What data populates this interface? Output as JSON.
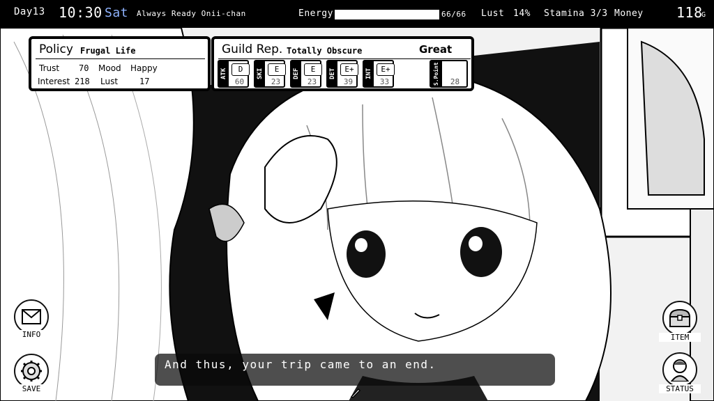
{
  "hud": {
    "day": "Day13",
    "time": "10:30",
    "weekday": "Sat",
    "title": "Always Ready Onii-chan",
    "energy_label": "Energy",
    "energy_value": "66/66",
    "energy_fraction": 1.0,
    "lust_label": "Lust",
    "lust_value": "14%",
    "stamina": "Stamina 3/3",
    "money_label": "Money",
    "money_value": "118",
    "money_unit": "G"
  },
  "policy": {
    "title": "Policy",
    "value": "Frugal Life",
    "trust_label": "Trust",
    "trust_value": "70",
    "mood_label": "Mood",
    "mood_value": "Happy",
    "interest_label": "Interest",
    "interest_value": "218",
    "lust_label": "Lust",
    "lust_value": "17"
  },
  "guild": {
    "title": "Guild Rep.",
    "rep": "Totally Obscure",
    "rating": "Great",
    "stats": [
      {
        "label": "ATK",
        "grade": "D",
        "value": "60"
      },
      {
        "label": "SKI",
        "grade": "E",
        "value": "23"
      },
      {
        "label": "DEF",
        "grade": "E",
        "value": "23"
      },
      {
        "label": "DET",
        "grade": "E+",
        "value": "39"
      },
      {
        "label": "INT",
        "grade": "E+",
        "value": "33"
      }
    ],
    "spoint_label": "S.Point",
    "spoint_value": "28"
  },
  "menu": {
    "info": "INFO",
    "save": "SAVE",
    "item": "ITEM",
    "status": "STATUS"
  },
  "dialog": {
    "text": "And thus, your trip came to an end."
  },
  "colors": {
    "hud_bg": "#000000",
    "weekday": "#8fb3ff"
  }
}
